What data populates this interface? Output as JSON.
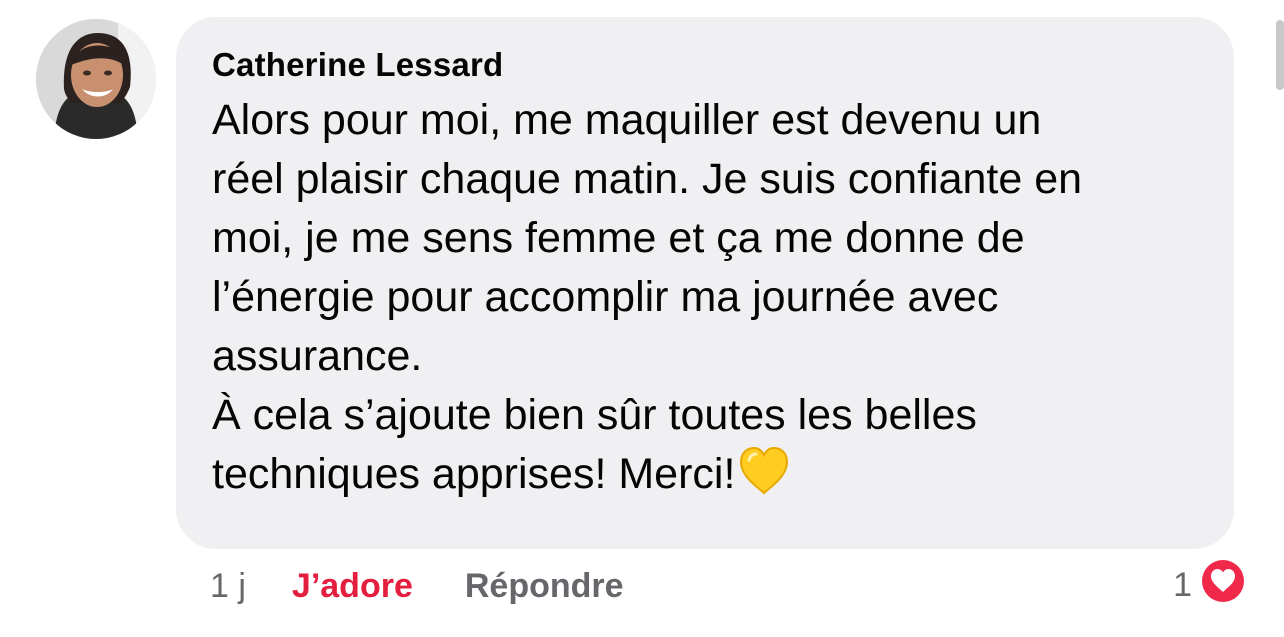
{
  "comment": {
    "author": "Catherine Lessard",
    "text": "Alors pour moi, me maquiller est devenu un\nréel plaisir chaque matin. Je suis confiante en\nmoi, je me sens femme et ça me donne de\nl’énergie pour accomplir ma journée avec\nassurance.\nÀ cela s’ajoute bien sûr toutes les belles\ntechniques apprises! Merci!",
    "emoji": "yellow-heart-icon",
    "timestamp": "1 j",
    "love_label": "J’adore",
    "reply_label": "Répondre",
    "reaction_count": "1",
    "reaction_icon": "love-reaction-icon"
  },
  "colors": {
    "bubble": "#f0f0f2",
    "love": "#e41e3f",
    "muted": "#65676b",
    "text": "#050505",
    "yellow_heart": "#ffcc22"
  }
}
